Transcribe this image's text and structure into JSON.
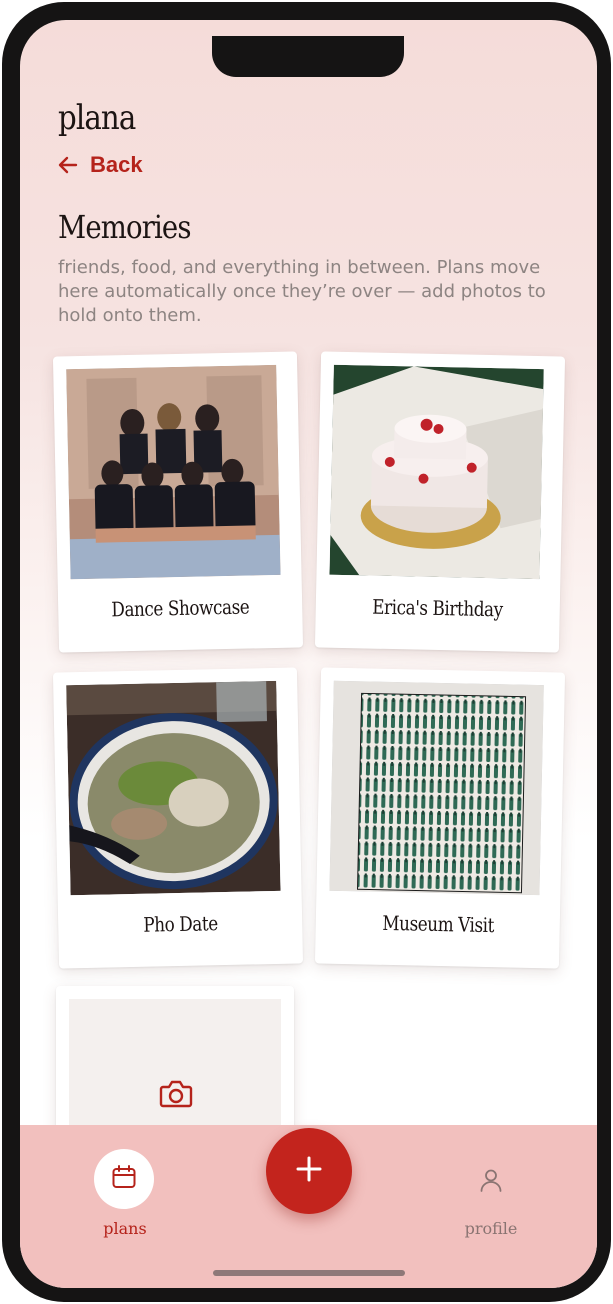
{
  "app": {
    "brand": "plana"
  },
  "nav": {
    "back_label": "Back",
    "back_icon": "arrow-left-icon"
  },
  "page": {
    "title": "Memories",
    "subtitle": "friends, food, and everything in between. Plans move here automatically once they’re over — add photos to hold onto them."
  },
  "memories": [
    {
      "caption": "Dance Showcase"
    },
    {
      "caption": "Erica's Birthday"
    },
    {
      "caption": "Pho Date"
    },
    {
      "caption": "Museum Visit"
    }
  ],
  "add_photo_card": {
    "icon": "camera-icon"
  },
  "tabbar": {
    "plans_label": "plans",
    "profile_label": "profile",
    "add_icon": "plus-icon"
  },
  "colors": {
    "accent": "#b5231b",
    "tabbar": "#f2c0be",
    "add_button": "#c3241d"
  }
}
